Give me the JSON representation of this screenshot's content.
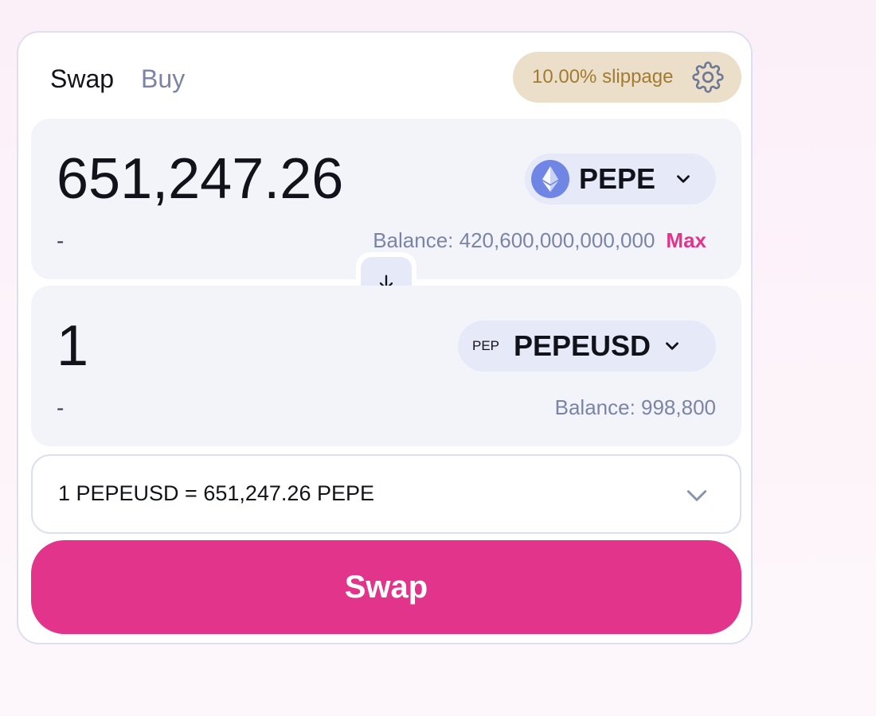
{
  "tabs": [
    {
      "label": "Swap",
      "active": true
    },
    {
      "label": "Buy",
      "active": false
    }
  ],
  "slippage": {
    "label": "10.00% slippage",
    "icon": "gear-icon"
  },
  "from": {
    "amount": "651,247.26",
    "usd_value": "-",
    "token": {
      "symbol": "PEPE",
      "icon": "ethereum-icon"
    },
    "balance_label": "Balance: 420,600,000,000,000",
    "max_label": "Max"
  },
  "swap_direction": {
    "icon": "arrow-down-icon"
  },
  "to": {
    "amount": "1",
    "usd_value": "-",
    "token": {
      "symbol": "PEPEUSD",
      "icon_text": "PEP"
    },
    "balance_label": "Balance: 998,800"
  },
  "rate": {
    "text": "1 PEPEUSD = 651,247.26 PEPE",
    "icon": "chevron-down-icon"
  },
  "action": {
    "label": "Swap"
  },
  "colors": {
    "accent": "#e3348b",
    "slippage_bg": "#ebdfc9",
    "slippage_text": "#a27b32",
    "panel_bg": "#f3f4fa",
    "muted_text": "#7b84a6"
  }
}
